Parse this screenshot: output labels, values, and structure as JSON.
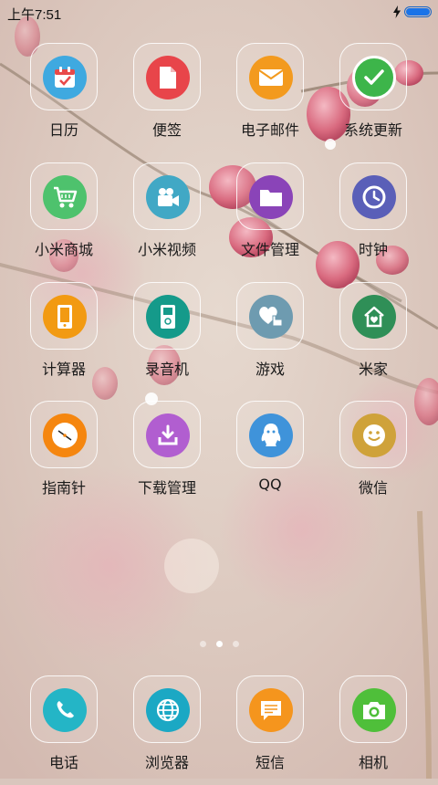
{
  "status_bar": {
    "time": "上午7:51",
    "charging_icon": "lightning-icon",
    "battery_level": 1.0,
    "battery_color": "#1a73e8"
  },
  "apps": [
    {
      "label": "日历",
      "icon": "calendar-icon",
      "color": "#3fa9e0"
    },
    {
      "label": "便签",
      "icon": "note-icon",
      "color": "#e8454a"
    },
    {
      "label": "电子邮件",
      "icon": "mail-icon",
      "color": "#f39a1e"
    },
    {
      "label": "系统更新",
      "icon": "check-icon",
      "color": "#3db54a"
    },
    {
      "label": "小米商城",
      "icon": "shopping-cart-icon",
      "color": "#4ec26d"
    },
    {
      "label": "小米视频",
      "icon": "video-camera-icon",
      "color": "#41a8c5"
    },
    {
      "label": "文件管理",
      "icon": "folder-icon",
      "color": "#8a44b8"
    },
    {
      "label": "时钟",
      "icon": "clock-icon",
      "color": "#5a5fb8"
    },
    {
      "label": "计算器",
      "icon": "calculator-icon",
      "color": "#f29a12"
    },
    {
      "label": "录音机",
      "icon": "recorder-icon",
      "color": "#159a8a"
    },
    {
      "label": "游戏",
      "icon": "heart-hand-icon",
      "color": "#6e9bb0"
    },
    {
      "label": "米家",
      "icon": "home-icon",
      "color": "#2f8f57"
    },
    {
      "label": "指南针",
      "icon": "compass-icon",
      "color": "#f5860f"
    },
    {
      "label": "下载管理",
      "icon": "download-icon",
      "color": "#b15ed0"
    },
    {
      "label": "QQ",
      "icon": "qq-penguin-icon",
      "color": "#3f93da"
    },
    {
      "label": "微信",
      "icon": "smiley-icon",
      "color": "#cfa23a"
    }
  ],
  "page_indicator": {
    "count": 3,
    "active": 1
  },
  "dock": [
    {
      "label": "电话",
      "icon": "phone-icon",
      "color": "#24b5c6"
    },
    {
      "label": "浏览器",
      "icon": "globe-icon",
      "color": "#1ba8c4"
    },
    {
      "label": "短信",
      "icon": "message-icon",
      "color": "#f5951d"
    },
    {
      "label": "相机",
      "icon": "camera-icon",
      "color": "#4fbf3a"
    }
  ]
}
